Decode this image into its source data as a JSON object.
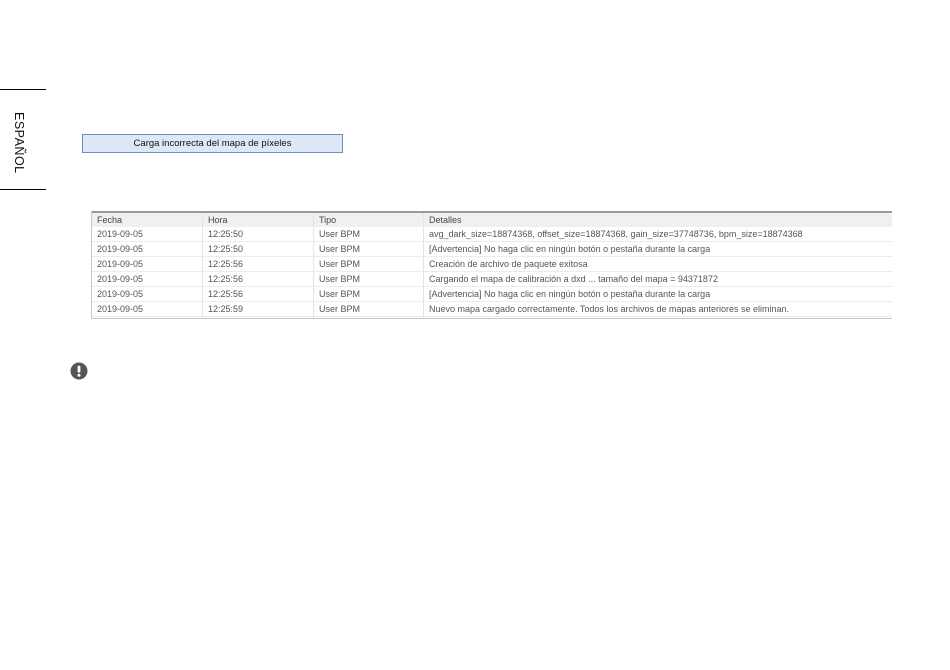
{
  "side_label": "ESPAÑOL",
  "banner": {
    "text": "Carga incorrecta del mapa de píxeles"
  },
  "log": {
    "headers": {
      "fecha": "Fecha",
      "hora": "Hora",
      "tipo": "Tipo",
      "detalles": "Detalles"
    },
    "rows": [
      {
        "fecha": "2019-09-05",
        "hora": "12:25:50",
        "tipo": "User BPM",
        "detalles": "avg_dark_size=18874368, offset_size=18874368, gain_size=37748736, bpm_size=18874368"
      },
      {
        "fecha": "2019-09-05",
        "hora": "12:25:50",
        "tipo": "User BPM",
        "detalles": "[Advertencia] No haga clic en ningún botón o pestaña durante la carga"
      },
      {
        "fecha": "2019-09-05",
        "hora": "12:25:56",
        "tipo": "User BPM",
        "detalles": "Creación de archivo de paquete exitosa"
      },
      {
        "fecha": "2019-09-05",
        "hora": "12:25:56",
        "tipo": "User BPM",
        "detalles": "Cargando el mapa de calibración a dxd ... tamaño del mapa = 94371872"
      },
      {
        "fecha": "2019-09-05",
        "hora": "12:25:56",
        "tipo": "User BPM",
        "detalles": "[Advertencia] No haga clic en ningún botón o pestaña durante la carga"
      },
      {
        "fecha": "2019-09-05",
        "hora": "12:25:59",
        "tipo": "User BPM",
        "detalles": "Nuevo mapa cargado correctamente. Todos los archivos de mapas anteriores se eliminan."
      }
    ]
  },
  "icons": {
    "note": "exclamation-circle-icon"
  },
  "colors": {
    "banner_bg": "#dde8f6",
    "banner_border": "#6f8fb8",
    "icon": "#555555"
  }
}
